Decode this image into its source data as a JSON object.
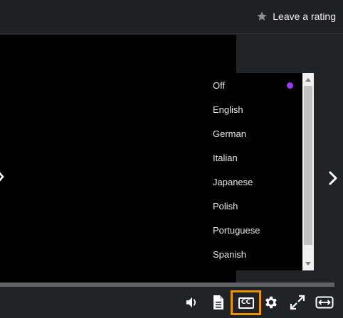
{
  "header": {
    "rating_label": "Leave a rating",
    "rating_icon": "star-icon"
  },
  "player": {
    "captions_menu": {
      "selected": "Off",
      "items": [
        {
          "label": "Off"
        },
        {
          "label": "English"
        },
        {
          "label": "German"
        },
        {
          "label": "Italian"
        },
        {
          "label": "Japanese"
        },
        {
          "label": "Polish"
        },
        {
          "label": "Portuguese"
        },
        {
          "label": "Spanish"
        }
      ],
      "selected_indicator_color": "#9b3cf0"
    },
    "controls": {
      "cc_label": "CC",
      "icons": [
        "volume-icon",
        "transcript-icon",
        "cc-icon",
        "settings-icon",
        "fullscreen-icon",
        "theater-mode-icon"
      ],
      "highlight_color": "#e69500"
    }
  }
}
